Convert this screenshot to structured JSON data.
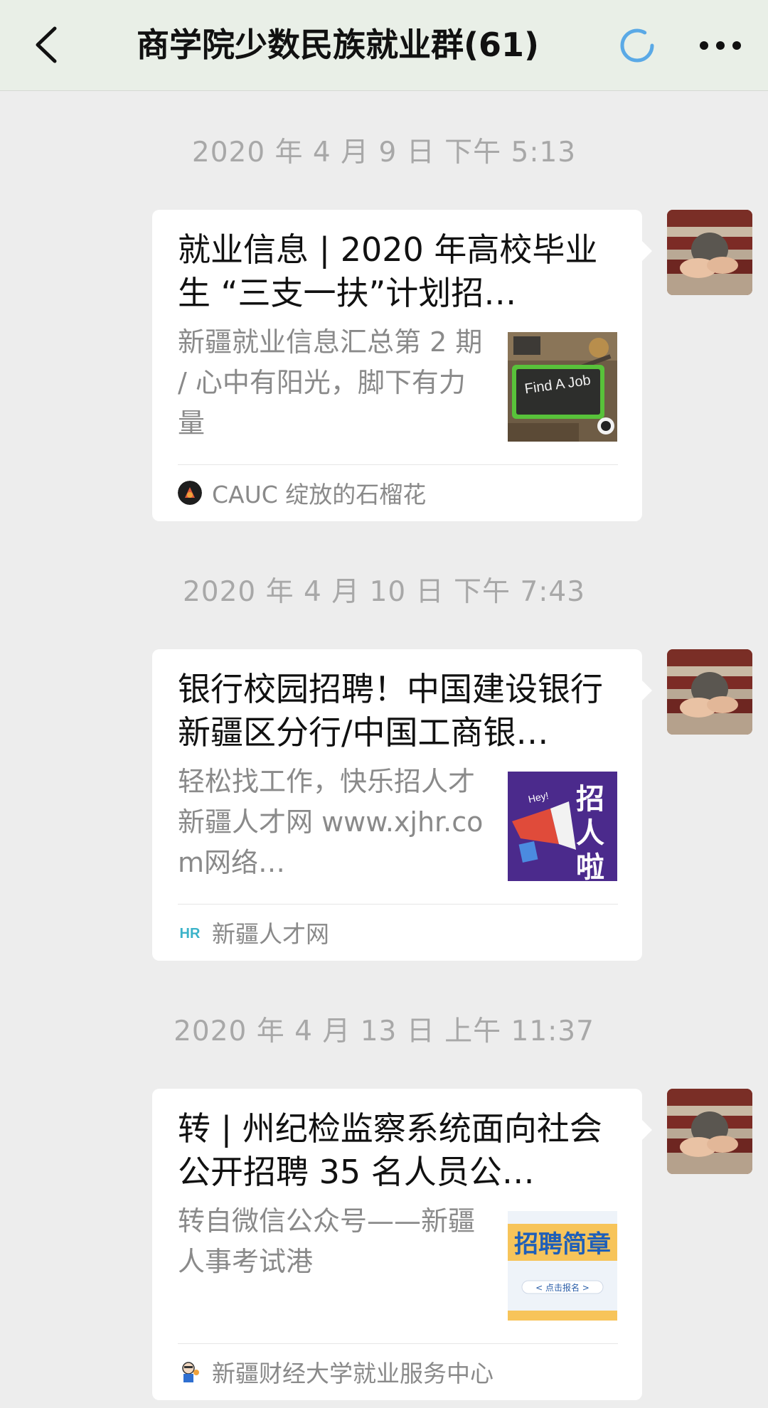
{
  "header": {
    "back_icon": "chevron-left-icon",
    "title": "商学院少数民族就业群(61)",
    "loading_icon": "loading-spinner-icon",
    "more_icon": "more-dots-icon"
  },
  "colors": {
    "header_bg": "#e9efe7",
    "chat_bg": "#ededed",
    "card_bg": "#ffffff",
    "spinner": "#5aa9e6",
    "timestamp": "#a8a8a8",
    "secondary_text": "#8a8a8a"
  },
  "messages": [
    {
      "timestamp": "2020 年 4 月 9 日 下午 5:13",
      "title": "就业信息 | 2020 年高校毕业生 “三支一扶”计划招…",
      "desc": "新疆就业信息汇总第 2 期 / 心中有阳光，脚下有力量",
      "thumb_text": "Find A Job",
      "source": "CAUC 绽放的石榴花",
      "source_icon": "pomegranate-flower-icon"
    },
    {
      "timestamp": "2020 年 4 月 10 日 下午 7:43",
      "title": "银行校园招聘！中国建设银行新疆区分行/中国工商银…",
      "desc": "轻松找工作，快乐招人才新疆人才网 www.xjhr.com网络…",
      "thumb_text": "招人啦",
      "thumb_small_text": "Hey!",
      "source": "新疆人才网",
      "source_icon": "hr-logo-icon"
    },
    {
      "timestamp": "2020 年 4 月 13 日 上午 11:37",
      "title": "转 | 州纪检监察系统面向社会公开招聘 35 名人员公…",
      "desc": "转自微信公众号——新疆人事考试港",
      "thumb_text": "招聘简章",
      "thumb_small_text": "< 点击报名 >",
      "source": "新疆财经大学就业服务中心",
      "source_icon": "cartoon-person-icon"
    }
  ]
}
